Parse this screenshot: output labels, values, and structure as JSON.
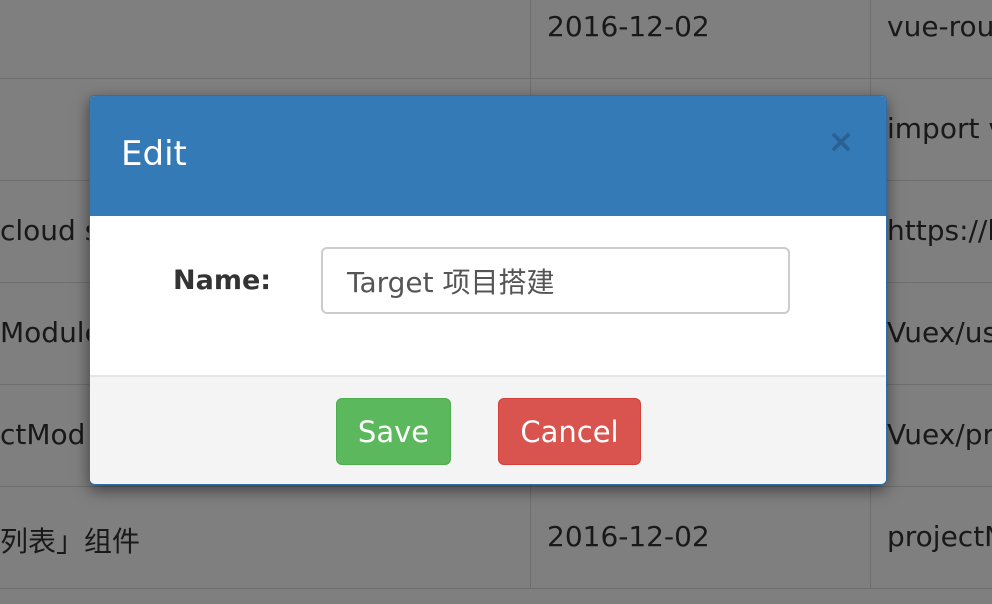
{
  "background_table": {
    "rows": [
      {
        "col1": "",
        "col2": "2016-12-02",
        "col3": "vue-rou"
      },
      {
        "col1": "",
        "col2": "",
        "col3": "import v"
      },
      {
        "col1": "cloud s",
        "col2": "",
        "col3": "https://l"
      },
      {
        "col1": "Module",
        "col2": "",
        "col3": "Vuex/us"
      },
      {
        "col1": "ctMod",
        "col2": "",
        "col3": "Vuex/pr"
      },
      {
        "col1": "列表」组件",
        "col2": "2016-12-02",
        "col3": "projectN"
      }
    ]
  },
  "modal": {
    "title": "Edit",
    "close_symbol": "×",
    "name_label": "Name:",
    "name_value": "Target 项目搭建",
    "save_label": "Save",
    "cancel_label": "Cancel"
  },
  "colors": {
    "header": "#337ab7",
    "save": "#5cb85c",
    "cancel": "#d9534f"
  }
}
